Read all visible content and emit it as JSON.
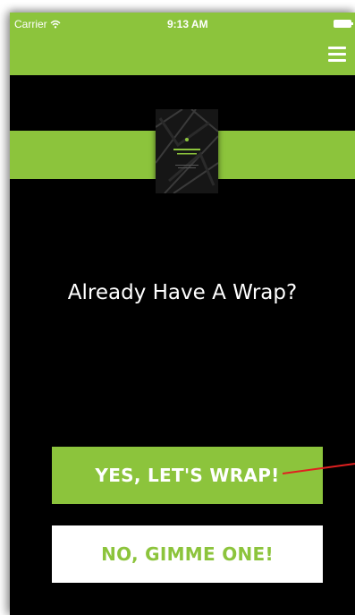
{
  "status_bar": {
    "carrier": "Carrier",
    "time": "9:13 AM"
  },
  "header": {
    "menu_icon": "hamburger-menu-icon",
    "color": "#8cc43c"
  },
  "hero": {
    "image": "product-package"
  },
  "main": {
    "heading": "Already Have A Wrap?",
    "primary_button_label": "YES, LET'S WRAP!",
    "secondary_button_label": "NO, GIMME ONE!"
  },
  "colors": {
    "accent": "#8cc43c",
    "background": "#000000",
    "annotation_arrow": "#e02020"
  }
}
